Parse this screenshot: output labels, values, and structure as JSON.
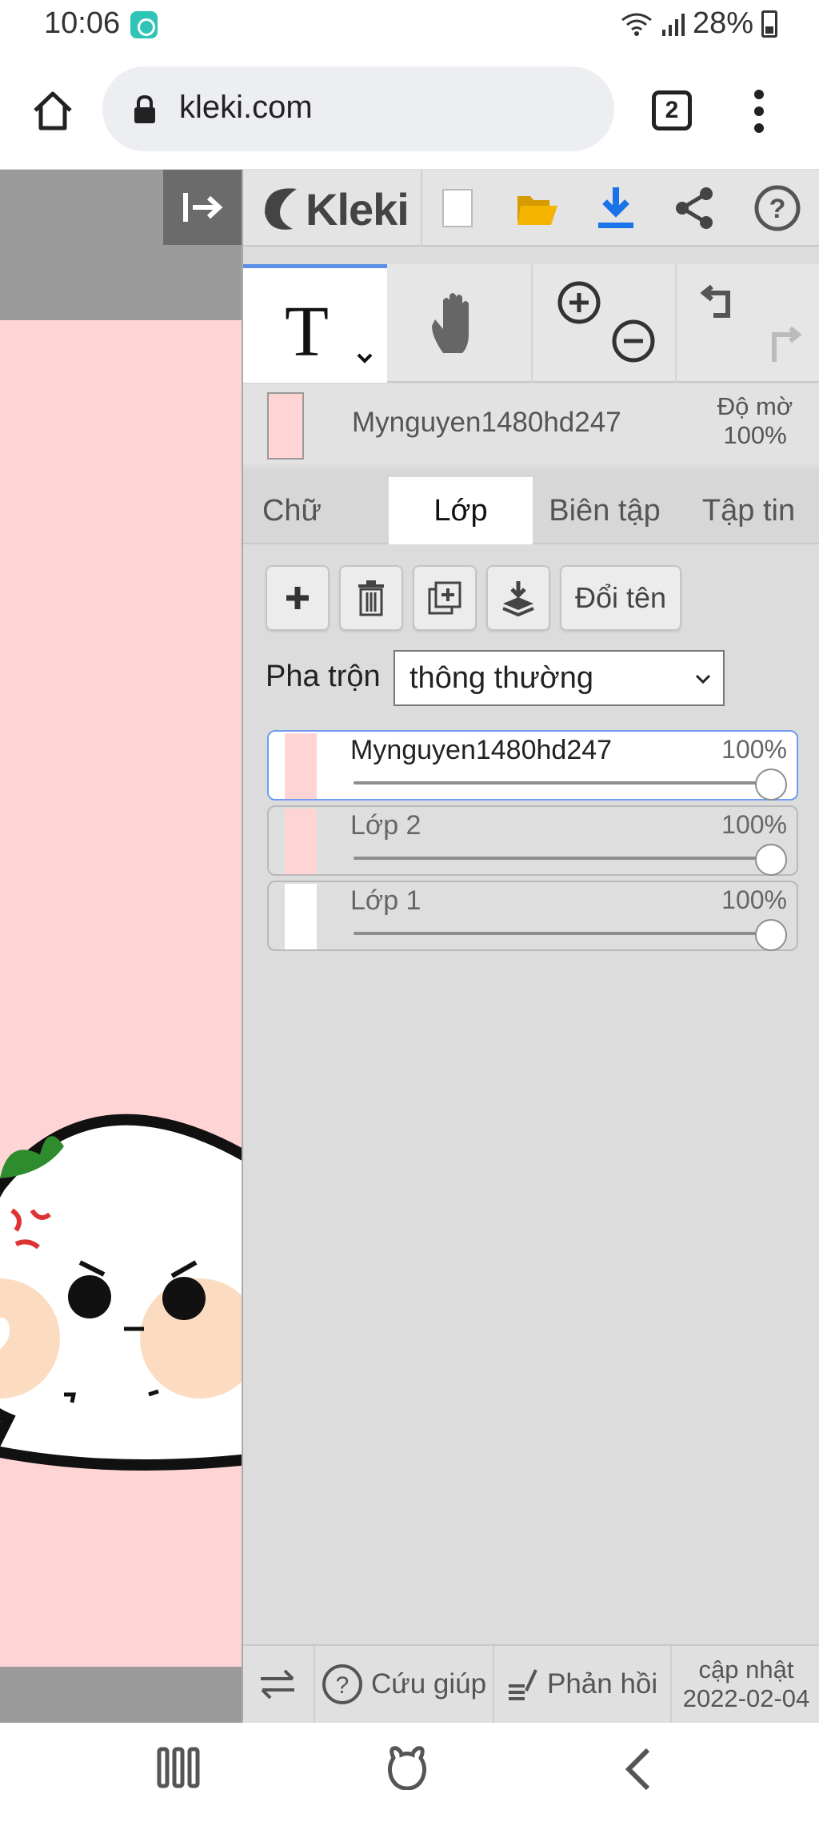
{
  "status_bar": {
    "time": "10:06",
    "battery": "28%"
  },
  "browser": {
    "url": "kleki.com",
    "tab_count": "2"
  },
  "app": {
    "name": "Kleki",
    "tools": {
      "active_tool": "T"
    },
    "current_layer": {
      "name": "Mynguyen1480hd247",
      "opacity_label": "Độ mờ",
      "opacity_value": "100%"
    },
    "tabs": [
      {
        "label": "Chữ",
        "active": false
      },
      {
        "label": "Lớp",
        "active": true
      },
      {
        "label": "Biên tập",
        "active": false
      },
      {
        "label": "Tập tin",
        "active": false
      }
    ],
    "layer_actions": {
      "rename_label": "Đổi tên"
    },
    "blend": {
      "label": "Pha trộn",
      "value": "thông thường"
    },
    "layers": [
      {
        "name": "Mynguyen1480hd247",
        "opacity": "100%",
        "opacity_value": 1.0,
        "active": true
      },
      {
        "name": "Lớp 2",
        "opacity": "100%",
        "opacity_value": 1.0,
        "active": false
      },
      {
        "name": "Lớp 1",
        "opacity": "100%",
        "opacity_value": 1.0,
        "active": false
      }
    ],
    "footer": {
      "help_label": "Cứu giúp",
      "feedback_label": "Phản hồi",
      "update_label": "cập nhật",
      "update_date": "2022-02-04"
    }
  },
  "colors": {
    "accent": "#5b8fe8",
    "canvas_bg": "#ffd4d5",
    "folder": "#f5b400",
    "download": "#1a73e8"
  }
}
